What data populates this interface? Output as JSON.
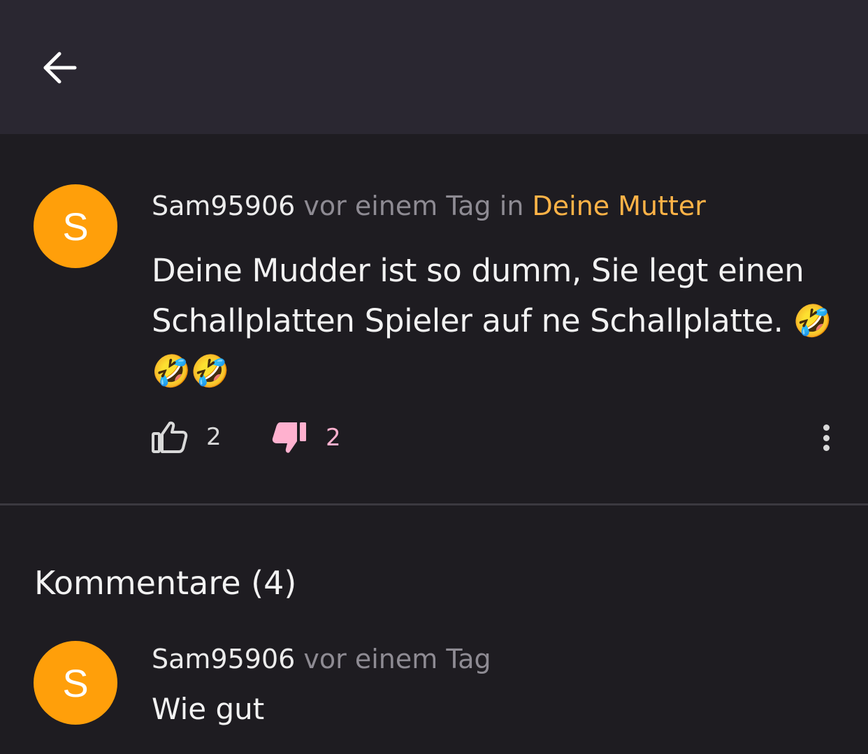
{
  "header": {
    "back_icon": "arrow-left-icon"
  },
  "post": {
    "avatar_letter": "S",
    "avatar_color": "#ff9f0a",
    "username": "Sam95906",
    "timestamp": "vor einem Tag",
    "in_label": "in",
    "community": "Deine Mutter",
    "community_color": "#ffb347",
    "body": "Deine Mudder ist so dumm, Sie legt einen Schallplatten Spieler auf ne Schallplatte. 🤣🤣🤣",
    "upvotes": "2",
    "downvotes": "2",
    "upvote_icon": "thumbs-up-outline-icon",
    "downvote_icon": "thumbs-down-filled-icon",
    "downvote_color": "#ffb1cf",
    "more_icon": "more-vertical-icon"
  },
  "comments": {
    "title": "Kommentare (4)",
    "items": [
      {
        "avatar_letter": "S",
        "username": "Sam95906",
        "timestamp": "vor einem Tag",
        "text": "Wie gut"
      }
    ]
  }
}
